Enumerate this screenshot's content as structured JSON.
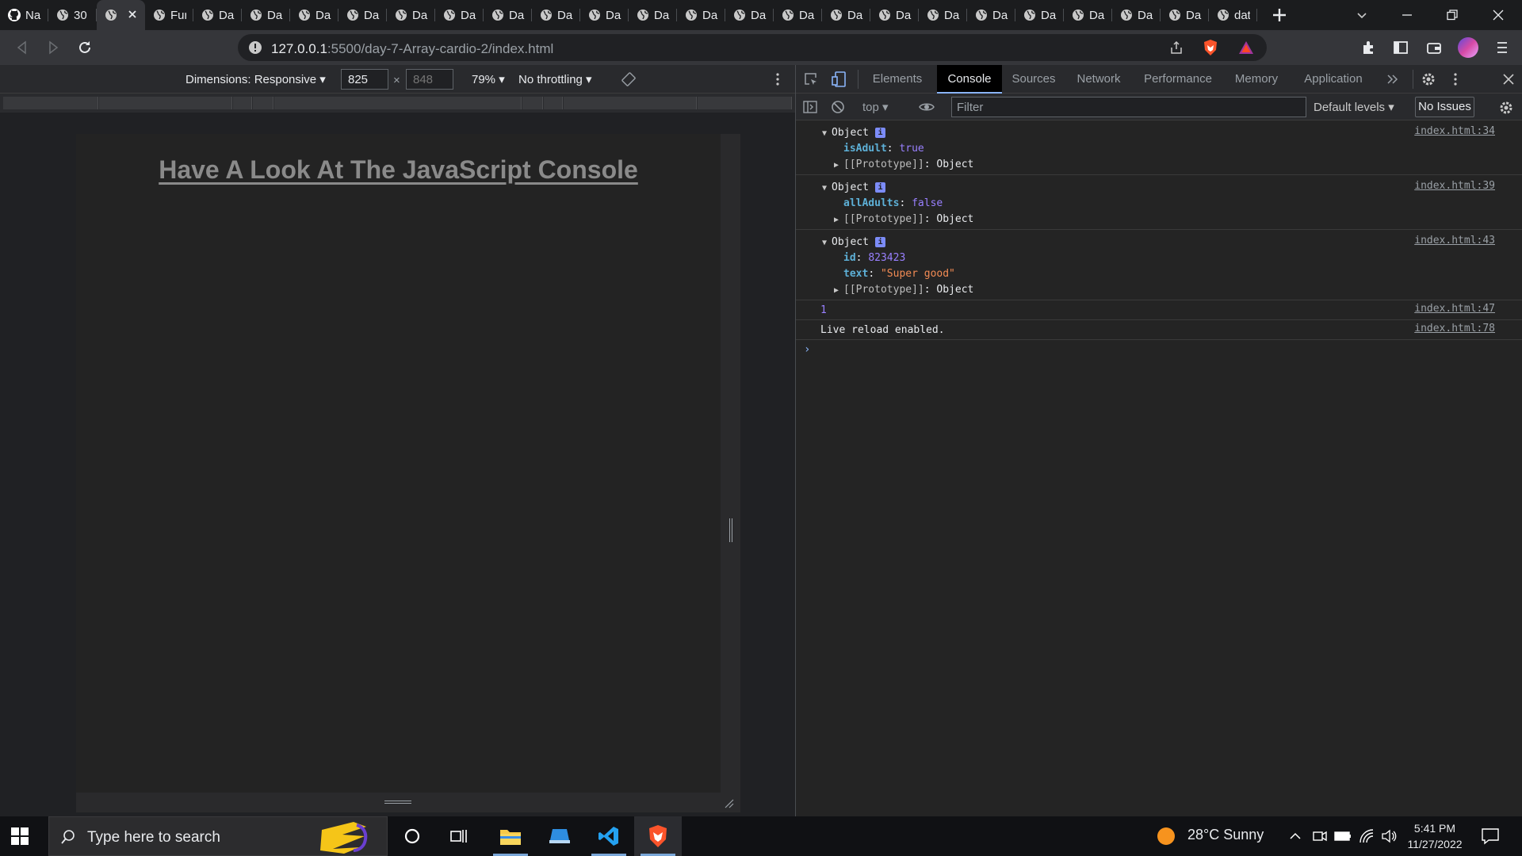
{
  "browser": {
    "tabs": [
      {
        "title": "Na",
        "icon": "github-icon"
      },
      {
        "title": "30",
        "icon": "globe-icon"
      },
      {
        "title": "",
        "icon": "globe-icon",
        "active": true
      },
      {
        "title": "Fur",
        "icon": "globe-icon"
      },
      {
        "title": "Da",
        "icon": "globe-icon"
      },
      {
        "title": "Da",
        "icon": "globe-icon"
      },
      {
        "title": "Da",
        "icon": "globe-icon"
      },
      {
        "title": "Da",
        "icon": "globe-icon"
      },
      {
        "title": "Da",
        "icon": "globe-icon"
      },
      {
        "title": "Da",
        "icon": "globe-icon"
      },
      {
        "title": "Da",
        "icon": "globe-icon"
      },
      {
        "title": "Da",
        "icon": "globe-icon"
      },
      {
        "title": "Da",
        "icon": "globe-icon"
      },
      {
        "title": "Da",
        "icon": "globe-icon"
      },
      {
        "title": "Da",
        "icon": "globe-icon"
      },
      {
        "title": "Da",
        "icon": "globe-icon"
      },
      {
        "title": "Da",
        "icon": "globe-icon"
      },
      {
        "title": "Da",
        "icon": "globe-icon"
      },
      {
        "title": "Da",
        "icon": "globe-icon"
      },
      {
        "title": "Da",
        "icon": "globe-icon"
      },
      {
        "title": "Da",
        "icon": "globe-icon"
      },
      {
        "title": "Da",
        "icon": "globe-icon"
      },
      {
        "title": "Da",
        "icon": "globe-icon"
      },
      {
        "title": "Da",
        "icon": "globe-icon"
      },
      {
        "title": "Da",
        "icon": "globe-icon"
      },
      {
        "title": "dat",
        "icon": "globe-icon"
      }
    ],
    "url_host": "127.0.0.1",
    "url_path": ":5500/day-7-Array-cardio-2/index.html"
  },
  "device_toolbar": {
    "dimensions_label": "Dimensions: Responsive",
    "width": "825",
    "height_placeholder": "848",
    "times": "×",
    "zoom": "79%",
    "throttling": "No throttling"
  },
  "page": {
    "heading": "Have A Look At The JavaScript Console"
  },
  "devtools": {
    "tabs": [
      "Elements",
      "Console",
      "Sources",
      "Network",
      "Performance",
      "Memory",
      "Application"
    ],
    "active_tab": "Console",
    "context": "top",
    "filter_placeholder": "Filter",
    "levels": "Default levels",
    "issues": "No Issues"
  },
  "console": {
    "entries": [
      {
        "source": "index.html:34",
        "header": "Object",
        "props": [
          {
            "key": "isAdult",
            "value": "true",
            "type": "kw"
          }
        ],
        "proto": "[[Prototype]]",
        "proto_value": "Object"
      },
      {
        "source": "index.html:39",
        "header": "Object",
        "props": [
          {
            "key": "allAdults",
            "value": "false",
            "type": "kw"
          }
        ],
        "proto": "[[Prototype]]",
        "proto_value": "Object"
      },
      {
        "source": "index.html:43",
        "header": "Object",
        "props": [
          {
            "key": "id",
            "value": "823423",
            "type": "num"
          },
          {
            "key": "text",
            "value": "\"Super good\"",
            "type": "str"
          }
        ],
        "proto": "[[Prototype]]",
        "proto_value": "Object"
      }
    ],
    "number_output": "1",
    "number_source": "index.html:47",
    "reload_output": "Live reload enabled.",
    "reload_source": "index.html:78"
  },
  "taskbar": {
    "search_placeholder": "Type here to search",
    "weather": "28°C  Sunny",
    "time": "5:41 PM",
    "date": "11/27/2022"
  },
  "colors": {
    "accent_blue": "#8ab4f8",
    "console_key": "#5db0d7",
    "console_keyword": "#9980ff",
    "console_string": "#f28b54"
  }
}
